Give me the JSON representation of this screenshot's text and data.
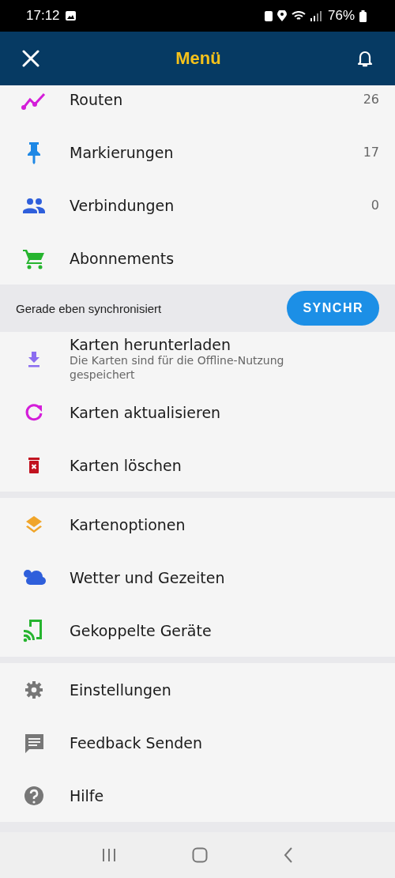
{
  "status_bar": {
    "time": "17:12",
    "battery": "76%"
  },
  "header": {
    "title": "Menü"
  },
  "sections": [
    {
      "items": [
        {
          "label": "Routen",
          "count": "26"
        },
        {
          "label": "Markierungen",
          "count": "17"
        },
        {
          "label": "Verbindungen",
          "count": "0"
        },
        {
          "label": "Abonnements"
        }
      ]
    },
    {
      "sync": {
        "status": "Gerade eben synchronisiert",
        "button": "SYNCHR"
      }
    },
    {
      "items": [
        {
          "label": "Karten herunterladen",
          "subtitle": "Die Karten sind für die Offline-Nutzung gespeichert"
        },
        {
          "label": "Karten aktualisieren"
        },
        {
          "label": "Karten löschen"
        }
      ]
    },
    {
      "items": [
        {
          "label": "Kartenoptionen"
        },
        {
          "label": "Wetter und Gezeiten"
        },
        {
          "label": "Gekoppelte Geräte"
        }
      ]
    },
    {
      "items": [
        {
          "label": "Einstellungen"
        },
        {
          "label": "Feedback Senden"
        },
        {
          "label": "Hilfe"
        }
      ]
    }
  ]
}
